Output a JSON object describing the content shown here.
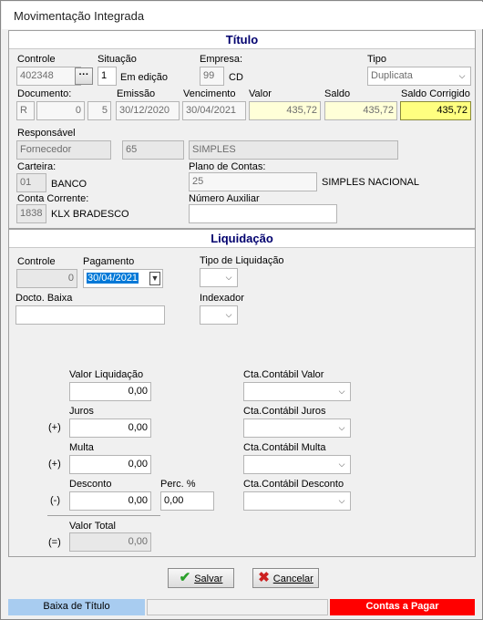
{
  "window": {
    "title": "Movimentação Integrada"
  },
  "titulo": {
    "header": "Título",
    "controle": {
      "label": "Controle",
      "value": "402348"
    },
    "situacao": {
      "label": "Situação",
      "value": "1",
      "text": "Em edição"
    },
    "empresa": {
      "label": "Empresa:",
      "value": "99",
      "text": "CD"
    },
    "tipo": {
      "label": "Tipo",
      "value": "Duplicata"
    },
    "documento": {
      "label": "Documento:",
      "prefix": "R",
      "number": "0",
      "parcela": "5"
    },
    "emissao": {
      "label": "Emissão",
      "value": "30/12/2020"
    },
    "vencimento": {
      "label": "Vencimento",
      "value": "30/04/2021"
    },
    "valor": {
      "label": "Valor",
      "value": "435,72"
    },
    "saldo": {
      "label": "Saldo",
      "value": "435,72"
    },
    "saldo_corrigido": {
      "label": "Saldo Corrigido",
      "value": "435,72"
    },
    "responsavel": {
      "label": "Responsável",
      "type": "Fornecedor",
      "code": "65",
      "name": "SIMPLES"
    },
    "carteira": {
      "label": "Carteira:",
      "code": "01",
      "name": "BANCO"
    },
    "plano_contas": {
      "label": "Plano de Contas:",
      "code": "25",
      "name": "SIMPLES NACIONAL"
    },
    "conta_corrente": {
      "label": "Conta Corrente:",
      "code": "1838",
      "name": "KLX BRADESCO"
    },
    "numero_auxiliar": {
      "label": "Número Auxiliar",
      "value": ""
    }
  },
  "liquidacao": {
    "header": "Liquidação",
    "controle": {
      "label": "Controle",
      "value": "0"
    },
    "pagamento": {
      "label": "Pagamento",
      "value": "30/04/2021"
    },
    "tipo_liquidacao": {
      "label": "Tipo de Liquidação",
      "value": ""
    },
    "docto_baixa": {
      "label": "Docto. Baixa",
      "value": ""
    },
    "indexador": {
      "label": "Indexador",
      "value": ""
    },
    "valor_liquidacao": {
      "label": "Valor Liquidação",
      "value": "0,00"
    },
    "cta_valor": {
      "label": "Cta.Contábil Valor",
      "value": ""
    },
    "juros": {
      "label": "Juros",
      "sign": "(+)",
      "value": "0,00"
    },
    "cta_juros": {
      "label": "Cta.Contábil Juros",
      "value": ""
    },
    "multa": {
      "label": "Multa",
      "sign": "(+)",
      "value": "0,00"
    },
    "cta_multa": {
      "label": "Cta.Contábil Multa",
      "value": ""
    },
    "desconto": {
      "label": "Desconto",
      "sign": "(-)",
      "value": "0,00"
    },
    "perc": {
      "label": "Perc. %",
      "value": "0,00"
    },
    "cta_desconto": {
      "label": "Cta.Contábil Desconto",
      "value": ""
    },
    "valor_total": {
      "label": "Valor Total",
      "sign": "(=)",
      "value": "0,00"
    }
  },
  "buttons": {
    "salvar": "Salvar",
    "cancelar": "Cancelar"
  },
  "status": {
    "left": "Baixa de Título",
    "right": "Contas a Pagar"
  },
  "colors": {
    "header_text": "#00006e",
    "saldo_corrigido": "#ffff80",
    "status_left": "#a8ccf0",
    "status_right": "#ff0000",
    "accept": "#2aa02a",
    "cancel": "#cc2020"
  }
}
